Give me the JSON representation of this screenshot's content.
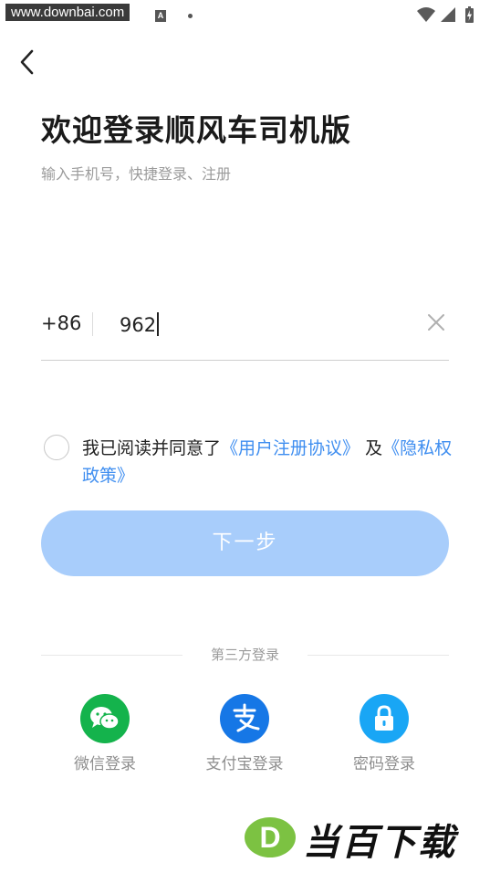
{
  "status_bar": {
    "watermark_url": "www.downbai.com",
    "keyboard_indicator": "A",
    "icons": [
      "wifi-icon",
      "cellular-signal-icon",
      "battery-charging-icon"
    ]
  },
  "header": {
    "back_icon": "chevron-left-icon"
  },
  "main": {
    "title": "欢迎登录顺风车司机版",
    "subtitle": "输入手机号，快捷登录、注册",
    "phone": {
      "country_code": "+86",
      "value": "962",
      "clear_icon": "close-icon"
    },
    "agreement": {
      "prefix": "我已阅读并同意了",
      "user_agreement": "《用户注册协议》",
      "conjunction": "及",
      "privacy_policy": "《隐私权政策》",
      "checked": false
    },
    "next_button": "下一步"
  },
  "third_party": {
    "label": "第三方登录",
    "options": [
      {
        "label": "微信登录",
        "icon": "wechat-icon",
        "color": "#14b34c"
      },
      {
        "label": "支付宝登录",
        "icon": "alipay-icon",
        "color": "#1677e6"
      },
      {
        "label": "密码登录",
        "icon": "lock-icon",
        "color": "#19a6f5"
      }
    ]
  },
  "colors": {
    "accent_link": "#3f8ef0",
    "button_disabled": "#a8cdfb"
  },
  "footer_watermark": {
    "logo_letter": "D",
    "brand_text": "当百下载"
  }
}
